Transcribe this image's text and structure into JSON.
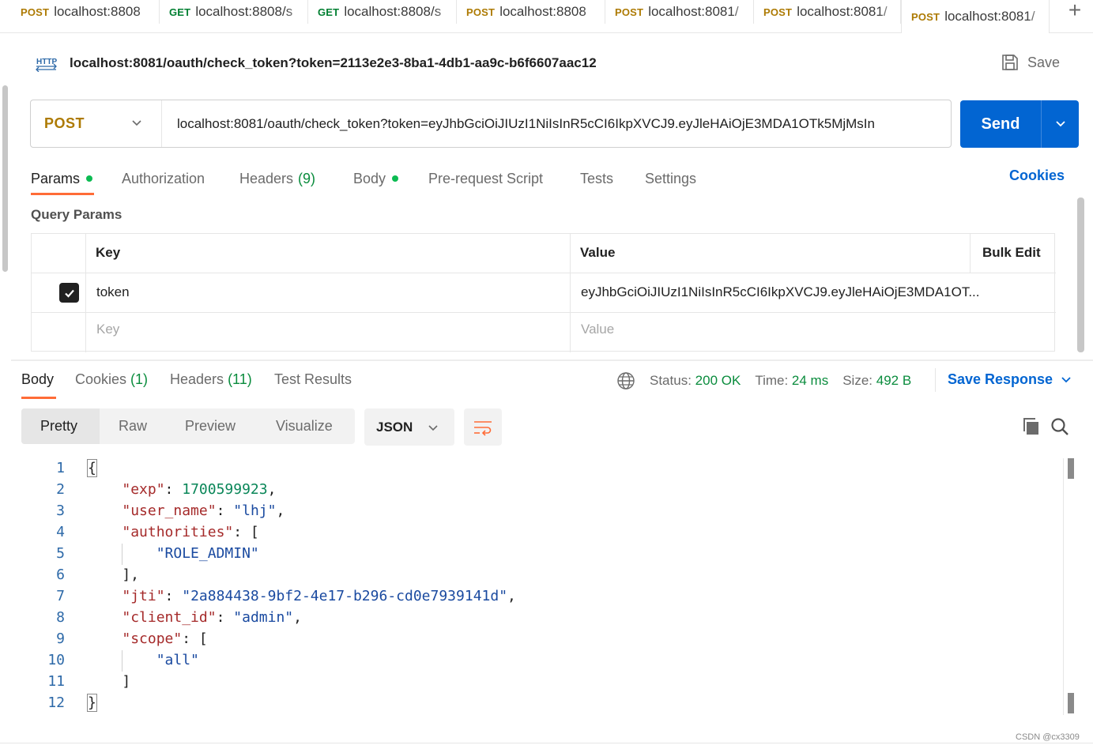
{
  "tabs": [
    {
      "method": "POST",
      "url": "localhost:8808"
    },
    {
      "method": "GET",
      "url": "localhost:8808/s"
    },
    {
      "method": "GET",
      "url": "localhost:8808/s"
    },
    {
      "method": "POST",
      "url": "localhost:8808"
    },
    {
      "method": "POST",
      "url": "localhost:8081/"
    },
    {
      "method": "POST",
      "url": "localhost:8081/"
    },
    {
      "method": "POST",
      "url": "localhost:8081/"
    }
  ],
  "new_tab_icon": "+",
  "request": {
    "title": "localhost:8081/oauth/check_token?token=2113e2e3-8ba1-4db1-aa9c-b6f6607aac12",
    "save_label": "Save",
    "method": "POST",
    "url": "localhost:8081/oauth/check_token?token=eyJhbGciOiJIUzI1NiIsInR5cCI6IkpXVCJ9.eyJleHAiOjE3MDA1OTk5MjMsIn",
    "send_label": "Send"
  },
  "request_tabs": {
    "params": "Params",
    "authorization": "Authorization",
    "headers": "Headers",
    "headers_count": "(9)",
    "body": "Body",
    "prerequest": "Pre-request Script",
    "tests": "Tests",
    "settings": "Settings",
    "cookies": "Cookies"
  },
  "query_params": {
    "title": "Query Params",
    "col_key": "Key",
    "col_value": "Value",
    "bulk_edit": "Bulk Edit",
    "rows": [
      {
        "key": "token",
        "value": "eyJhbGciOiJIUzI1NiIsInR5cCI6IkpXVCJ9.eyJleHAiOjE3MDA1OT...",
        "checked": true
      }
    ],
    "placeholder_key": "Key",
    "placeholder_value": "Value"
  },
  "response_tabs": {
    "body": "Body",
    "cookies": "Cookies",
    "cookies_count": "(1)",
    "headers": "Headers",
    "headers_count": "(11)",
    "test_results": "Test Results"
  },
  "response_status": {
    "status_label": "Status:",
    "status_value": "200 OK",
    "time_label": "Time:",
    "time_value": "24 ms",
    "size_label": "Size:",
    "size_value": "492 B",
    "save_response": "Save Response"
  },
  "view_modes": {
    "pretty": "Pretty",
    "raw": "Raw",
    "preview": "Preview",
    "visualize": "Visualize",
    "format": "JSON"
  },
  "code_lines": [
    {
      "n": "1"
    },
    {
      "n": "2"
    },
    {
      "n": "3"
    },
    {
      "n": "4"
    },
    {
      "n": "5"
    },
    {
      "n": "6"
    },
    {
      "n": "7"
    },
    {
      "n": "8"
    },
    {
      "n": "9"
    },
    {
      "n": "10"
    },
    {
      "n": "11"
    },
    {
      "n": "12"
    }
  ],
  "json_body": {
    "open": "{",
    "close": "}",
    "exp_key": "\"exp\"",
    "exp_val": "1700599923",
    "user_name_key": "\"user_name\"",
    "user_name_val": "\"lhj\"",
    "authorities_key": "\"authorities\"",
    "role_val": "\"ROLE_ADMIN\"",
    "jti_key": "\"jti\"",
    "jti_val": "\"2a884438-9bf2-4e17-b296-cd0e7939141d\"",
    "client_id_key": "\"client_id\"",
    "client_id_val": "\"admin\"",
    "scope_key": "\"scope\"",
    "scope_val": "\"all\""
  },
  "watermark": "CSDN @cx3309",
  "colors": {
    "post": "#ad7a03",
    "get": "#007f31",
    "accent": "#ff6c37",
    "primary": "#0265d2",
    "success": "#0a8c3d"
  }
}
